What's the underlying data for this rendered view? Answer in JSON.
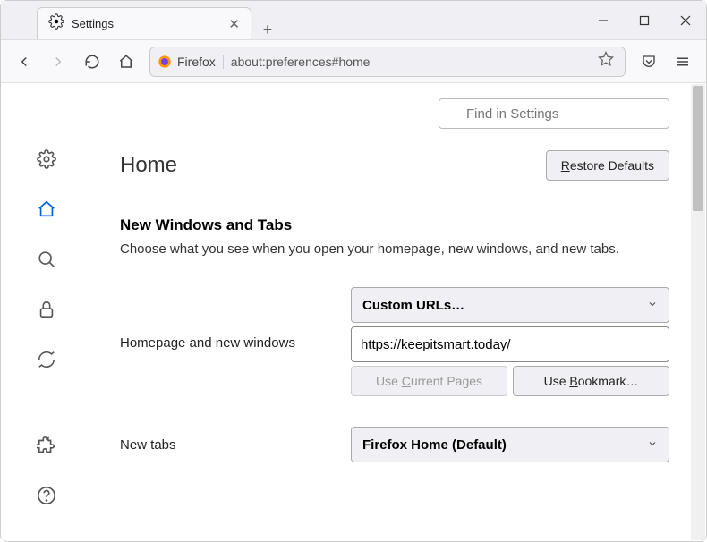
{
  "tab": {
    "label": "Settings"
  },
  "url": {
    "prefix": "Firefox",
    "path": "about:preferences#home"
  },
  "search": {
    "placeholder": "Find in Settings"
  },
  "page": {
    "title": "Home",
    "restore": "Restore Defaults"
  },
  "section": {
    "title": "New Windows and Tabs",
    "desc": "Choose what you see when you open your homepage, new windows, and new tabs."
  },
  "homepage": {
    "label": "Homepage and new windows",
    "dropdown": "Custom URLs…",
    "url": "https://keepitsmart.today/",
    "use_current": "Use Current Pages",
    "use_bookmark": "Use Bookmark…"
  },
  "newtabs": {
    "label": "New tabs",
    "dropdown": "Firefox Home (Default)"
  }
}
